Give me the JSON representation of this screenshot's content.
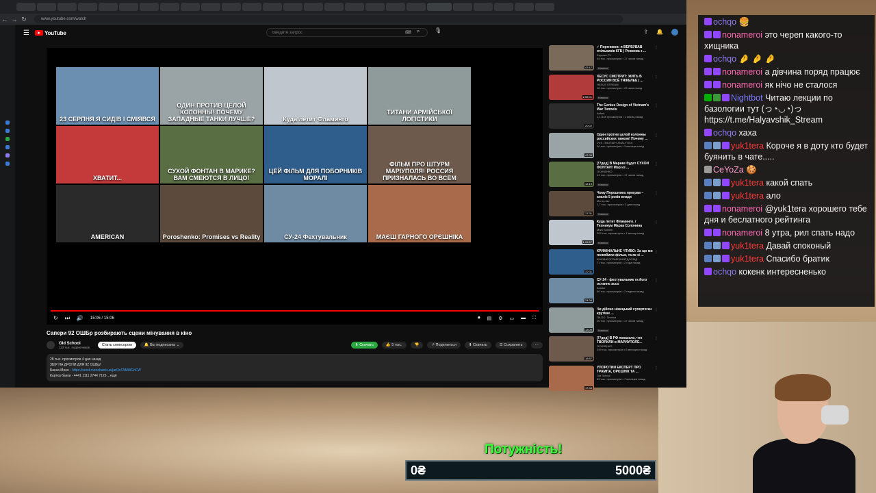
{
  "browser": {
    "url": "www.youtube.com/watch",
    "nav": {
      "back": "←",
      "forward": "→",
      "reload": "↻"
    }
  },
  "youtube": {
    "logo": "YouTube",
    "search_placeholder": "Введите запрос",
    "player": {
      "time": "15:06 / 15:06",
      "thumbnails": [
        {
          "text": "23 СЕРПНЯ Я СИДІВ І СМІЯВСЯ",
          "color": "#6b8fb0"
        },
        {
          "text": "ОДИН ПРОТИВ ЦЕЛОЙ КОЛОННЫ! ПОЧЕМУ ЗАПАДНЫЕ ТАНКИ ЛУЧШЕ?",
          "color": "#9aa3a6"
        },
        {
          "text": "Куда летит Фламинго",
          "color": "#bfc6ce"
        },
        {
          "text": "ТИТАНИ АРМІЙСЬКОЇ ЛОГІСТИКИ",
          "color": "#8f9b9a"
        },
        {
          "text": "ХВАТИТ...",
          "color": "#c43a3a"
        },
        {
          "text": "СУХОЙ ФОНТАН В МАРИКЕ? ВАМ СМЕЮТСЯ В ЛИЦО!",
          "color": "#5a6e44"
        },
        {
          "text": "ЦЕЙ ФІЛЬМ ДЛЯ ПОБОРНИКІВ МОРАЛІ",
          "color": "#2f5d8c"
        },
        {
          "text": "ФІЛЬМ ПРО ШТУРМ МАРІУПОЛЯ! РОССИЯ ПРИЗНАЛАСЬ ВО ВСЕМ",
          "color": "#6d5a4c"
        },
        {
          "text": "AMERICAN",
          "color": "#2a2a2a"
        },
        {
          "text": "Poroshenko: Promises vs Reality",
          "color": "#5c4a3c"
        },
        {
          "text": "СУ-24 Фехтувальник",
          "color": "#6f8aa3"
        },
        {
          "text": "МАЄШ ГАРНОГО ОРЄШНІКА",
          "color": "#a86a4a"
        }
      ]
    },
    "video": {
      "title": "Сапери 92 ОШБр розбирають сцени мінування в кіно",
      "channel": "Old School",
      "subs": "113 тыс. подписчиков",
      "sponsor": "Стать спонсором",
      "subscribed": "Вы подписаны",
      "download_green": "Скачать",
      "likes": "5 тыс.",
      "share": "Поделиться",
      "download": "Скачать",
      "save": "Сохранить",
      "desc_line1": "28 тыс. просмотров  4 дня назад",
      "desc_line2": "ЗБІР НА ДРОНИ ДЛЯ 92 ОШБр!",
      "desc_line3_label": "Банка Моно - ",
      "desc_link": "https://send.monobank.ua/jar/3sTAMWGnFW",
      "desc_line4": "Картка банки - 4441 1111 2744 7125  ...ещё"
    },
    "related": [
      {
        "title": "⚡ Портников: я ВЕРБУВАВ очільників КГБ | Розмова з ...",
        "channel": "Espreso.TV",
        "meta": "44 тыс. просмотров • 17 часов назад",
        "badge": "Новинка",
        "dur": "47:17",
        "color": "#7a6a5a"
      },
      {
        "title": "ХЕСУС СМОТРИТ: ЖИТЬ В РОССИИ ВСЁ ТЯЖЕЛЕЕ | ...",
        "channel": "HESUS STREAM",
        "meta": "16 тыс. просмотров • 23 часа назад",
        "badge": "Новинка",
        "dur": "2:55:01",
        "color": "#b13a3a"
      },
      {
        "title": "The Genius Design of Vietnam's War Tunnels",
        "channel": "Airfork",
        "meta": "1,1 млн просмотров • 1 месяц назад",
        "badge": "",
        "dur": "20:02",
        "color": "#2c2c2c"
      },
      {
        "title": "Один против целой колонны российских танков! Почему ...",
        "channel": "VVS - MILITARY ANALYTICS",
        "meta": "26 тыс. просмотров • 3 месяца назад",
        "badge": "",
        "dur": "47:05",
        "color": "#9aa3a6"
      },
      {
        "title": "[!?дед] В Марике будет СУХОЙ ФОНТАН! Мэр из ...",
        "channel": "ОСИЧЕНКО",
        "meta": "14 тыс. просмотров • 17 часов назад",
        "badge": "Новинка",
        "dur": "12:19",
        "color": "#5a6e44"
      },
      {
        "title": "Чому Порошенко програв – аналіз 5 років влади",
        "channel": "Містер Ікс",
        "meta": "1,7 тыс. просмотров • 2 дня назад",
        "badge": "Новинка",
        "dur": "17:31",
        "color": "#5c4a3c"
      },
      {
        "title": "Куда летит Фламинго. / Техникум Марка Солонина",
        "channel": "Mark Solonin",
        "meta": "202 тыс. просмотров • 1 месяц назад",
        "badge": "Новинка",
        "dur": "1:26:57",
        "color": "#bfc6ce"
      },
      {
        "title": "КРИМІНАЛЬНЕ ЧТИВО: За що ми полюбили фільм, та як зі ...",
        "channel": "КІНЕМАТОГРАФІЧНИЙ ДОСВІД",
        "meta": "71 тыс. просмотров • 2 года назад",
        "badge": "",
        "dur": "22:11",
        "color": "#2f5d8c"
      },
      {
        "title": "СУ-24 - фехтувальник та його останнє ассо",
        "channel": "Aviator",
        "meta": "60 тыс. просмотров • 2 недели назад",
        "badge": "",
        "dur": "24:34",
        "color": "#6f8aa3"
      },
      {
        "title": "Чи дійсно німецький супертягач крутіше ...",
        "channel": "ПА.БО. Техніка",
        "meta": "26 тыс. просмотров • 17 часов назад",
        "badge": "Новинка",
        "dur": "13:09",
        "color": "#8f9b9a"
      },
      {
        "title": "[!?дед] В РФ показали, что ТВОРИЛИ в МАРИУПОЛЕ...",
        "channel": "ОСИЧЕНКО",
        "meta": "249 тыс. просмотров • 8 месяцев назад",
        "badge": "",
        "dur": "16:57",
        "color": "#6d5a4c"
      },
      {
        "title": "УПОРОТИЙ ЕКСПЕРТ ПРО ТРАМПА, ОРЄШНІК ТА ...",
        "channel": "Old School",
        "meta": "53 тыс. просмотров • 7 месяцев назад",
        "badge": "",
        "dur": "17:44",
        "color": "#a86a4a"
      }
    ]
  },
  "chat": [
    {
      "nick": "ochqo",
      "nick_color": "#8e7cf0",
      "text": "🍔",
      "badges": [
        "#9147ff"
      ]
    },
    {
      "nick": "nonameroi",
      "nick_color": "#ff69b4",
      "text": "это череп какого-то хищника",
      "badges": [
        "#9147ff",
        "#9147ff"
      ]
    },
    {
      "nick": "ochqo",
      "nick_color": "#8e7cf0",
      "text": "🤌 🤌 🤌",
      "badges": [
        "#9147ff"
      ]
    },
    {
      "nick": "nonameroi",
      "nick_color": "#ff69b4",
      "text": "а дівчина поряд працює",
      "badges": [
        "#9147ff",
        "#9147ff"
      ]
    },
    {
      "nick": "nonameroi",
      "nick_color": "#ff69b4",
      "text": "як нічо не сталося",
      "badges": [
        "#9147ff",
        "#9147ff"
      ]
    },
    {
      "nick": "Nightbot",
      "nick_color": "#7b7bff",
      "text": "Читаю лекции по базологии тут (っ◔◡◔)っ https://t.me/Halyavshik_Stream",
      "badges": [
        "#00ad03",
        "#3a9a3a",
        "#9147ff"
      ]
    },
    {
      "nick": "ochqo",
      "nick_color": "#8e7cf0",
      "text": "хаха",
      "badges": [
        "#9147ff"
      ]
    },
    {
      "nick": "yuk1tera",
      "nick_color": "#ff3a3a",
      "text": "Короче я в доту кто будет буянить в чате.....",
      "badges": [
        "#5a7fbf",
        "#7a9fcf",
        "#9147ff"
      ]
    },
    {
      "nick": "CeYoZa",
      "nick_color": "#ff9bd0",
      "text": "🍪",
      "badges": [
        "#9a9a9a"
      ]
    },
    {
      "nick": "yuk1tera",
      "nick_color": "#ff3a3a",
      "text": "какой спать",
      "badges": [
        "#5a7fbf",
        "#7a9fcf",
        "#9147ff"
      ]
    },
    {
      "nick": "yuk1tera",
      "nick_color": "#ff3a3a",
      "text": "ало",
      "badges": [
        "#5a7fbf",
        "#7a9fcf",
        "#9147ff"
      ]
    },
    {
      "nick": "nonameroi",
      "nick_color": "#ff69b4",
      "text": "@yuk1tera хорошего тебе дня и беслатного рейтинга",
      "badges": [
        "#9147ff",
        "#9147ff"
      ]
    },
    {
      "nick": "nonameroi",
      "nick_color": "#ff69b4",
      "text": "8 утра, рил спать надо",
      "badges": [
        "#9147ff",
        "#9147ff"
      ]
    },
    {
      "nick": "yuk1tera",
      "nick_color": "#ff3a3a",
      "text": "Давай споконый",
      "badges": [
        "#5a7fbf",
        "#7a9fcf",
        "#9147ff"
      ]
    },
    {
      "nick": "yuk1tera",
      "nick_color": "#ff3a3a",
      "text": "Спасибо братик",
      "badges": [
        "#5a7fbf",
        "#7a9fcf",
        "#9147ff"
      ]
    },
    {
      "nick": "ochqo",
      "nick_color": "#8e7cf0",
      "text": "кокенк интересненько",
      "badges": [
        "#9147ff"
      ]
    }
  ],
  "donation": {
    "headline": "Потужність!",
    "current": "0₴",
    "goal": "5000₴",
    "progress_fraction": 0
  }
}
